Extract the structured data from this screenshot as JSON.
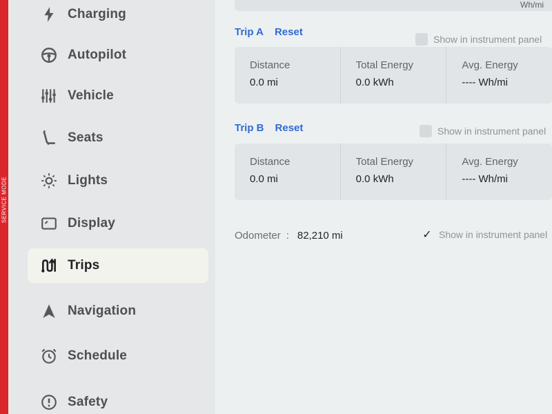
{
  "service_mode": {
    "label": "SERVICE MODE",
    "color": "#d8262b"
  },
  "sidebar": {
    "items": [
      {
        "label": "Charging",
        "icon": "lightning-bolt-icon",
        "active": false
      },
      {
        "label": "Autopilot",
        "icon": "steering-wheel-icon",
        "active": false
      },
      {
        "label": "Vehicle",
        "icon": "sliders-icon",
        "active": false
      },
      {
        "label": "Seats",
        "icon": "seat-icon",
        "active": false
      },
      {
        "label": "Lights",
        "icon": "sun-icon",
        "active": false
      },
      {
        "label": "Display",
        "icon": "display-icon",
        "active": false
      },
      {
        "label": "Trips",
        "icon": "trips-icon",
        "active": true
      },
      {
        "label": "Navigation",
        "icon": "navigation-arrow-icon",
        "active": false
      },
      {
        "label": "Schedule",
        "icon": "alarm-clock-icon",
        "active": false
      },
      {
        "label": "Safety",
        "icon": "alert-circle-icon",
        "active": false
      }
    ]
  },
  "top_partial": {
    "text": "Wh/mi"
  },
  "trips": [
    {
      "title": "Trip A",
      "reset_label": "Reset",
      "show_label": "Show in instrument panel",
      "show_checked": false,
      "metrics": [
        {
          "label": "Distance",
          "value": "0.0  mi"
        },
        {
          "label": "Total Energy",
          "value": "0.0  kWh"
        },
        {
          "label": "Avg. Energy",
          "value": "----  Wh/mi"
        }
      ]
    },
    {
      "title": "Trip B",
      "reset_label": "Reset",
      "show_label": "Show in instrument panel",
      "show_checked": false,
      "metrics": [
        {
          "label": "Distance",
          "value": "0.0  mi"
        },
        {
          "label": "Total Energy",
          "value": "0.0  kWh"
        },
        {
          "label": "Avg. Energy",
          "value": "----  Wh/mi"
        }
      ]
    }
  ],
  "odometer": {
    "label": "Odometer",
    "separator": ":",
    "value": "82,210 mi",
    "show_label": "Show in instrument panel",
    "show_checked": true
  },
  "colors": {
    "accent": "#2f6bd3",
    "active_background": "#f3f3ee"
  }
}
